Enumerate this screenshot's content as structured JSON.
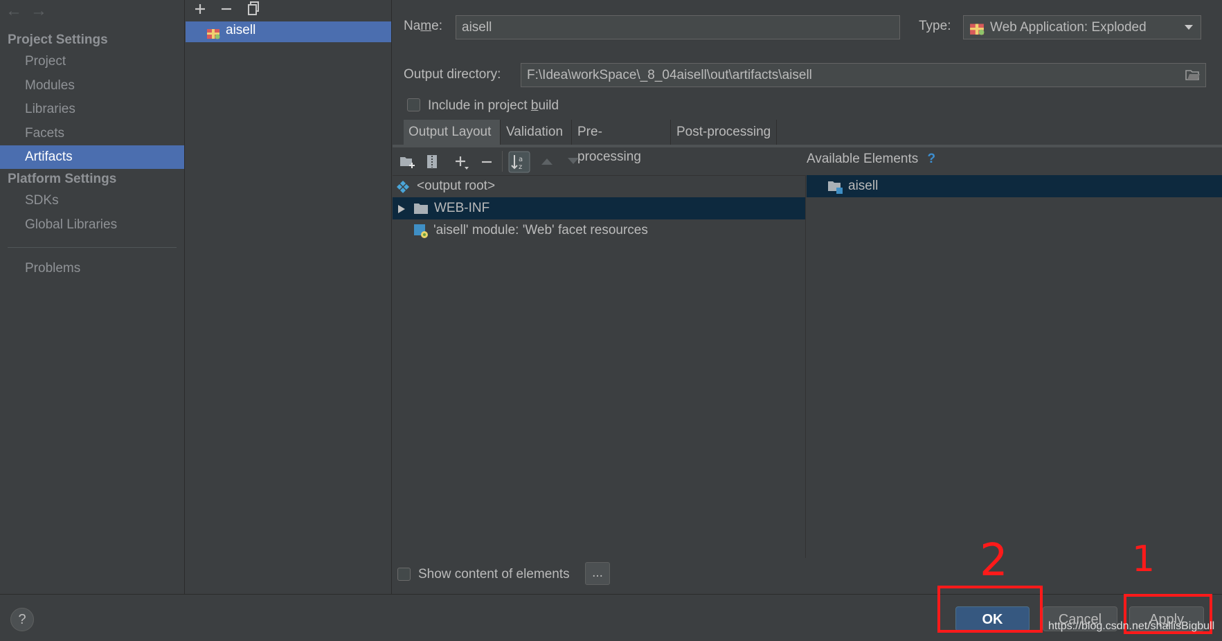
{
  "nav": {
    "back_arrow": "←",
    "forward_arrow": "→",
    "project_settings_header": "Project Settings",
    "project_items": [
      {
        "label": "Project"
      },
      {
        "label": "Modules"
      },
      {
        "label": "Libraries"
      },
      {
        "label": "Facets"
      },
      {
        "label": "Artifacts",
        "selected": true
      }
    ],
    "platform_settings_header": "Platform Settings",
    "platform_items": [
      {
        "label": "SDKs"
      },
      {
        "label": "Global Libraries"
      }
    ],
    "problems_label": "Problems"
  },
  "artifacts": {
    "toolbar_icons": [
      "add-icon",
      "remove-icon",
      "copy-icon"
    ],
    "items": [
      {
        "label": "aisell",
        "icon": "war-exploded-icon",
        "selected": true
      }
    ]
  },
  "details": {
    "name_label_prefix": "Na",
    "name_label_mnemonic": "m",
    "name_label_suffix": "e:",
    "name_value": "aisell",
    "type_label": "Type:",
    "type_value": "Web Application: Exploded",
    "output_dir_label": "Output directory:",
    "output_dir_value": "F:\\Idea\\workSpace\\_8_04aisell\\out\\artifacts\\aisell",
    "include_build_prefix": "Include in project ",
    "include_build_mnemonic": "b",
    "include_build_suffix": "uild",
    "include_build_checked": false
  },
  "tabs": [
    {
      "label": "Output Layout",
      "selected": true
    },
    {
      "label": "Validation"
    },
    {
      "label": "Pre-processing"
    },
    {
      "label": "Post-processing"
    }
  ],
  "layout": {
    "toolbar_icons": [
      "new-directory-icon",
      "archive-icon",
      "add-copy-icon",
      "remove-icon",
      "sort-icon",
      "move-up-icon",
      "move-down-icon"
    ],
    "tree": [
      {
        "label": "<output root>",
        "icon": "output-root-icon",
        "level": 0
      },
      {
        "label": "WEB-INF",
        "icon": "folder-icon",
        "level": 0,
        "expandable": true,
        "highlighted": true
      },
      {
        "label": "'aisell' module: 'Web' facet resources",
        "icon": "facet-resources-icon",
        "level": 1
      }
    ],
    "show_content_label": "Show content of elements",
    "show_content_checked": false,
    "more_button_label": "..."
  },
  "available": {
    "header": "Available Elements",
    "help_glyph": "?",
    "items": [
      {
        "label": "aisell",
        "icon": "module-folder-icon"
      }
    ]
  },
  "buttons": {
    "help": "?",
    "ok": "OK",
    "cancel": "Cancel",
    "apply": "Apply"
  },
  "annotations": {
    "ok_number": "2",
    "apply_number": "1",
    "color": "#ff1a1a"
  },
  "watermark": "https://blog.csdn.net/shallisBigbull",
  "colors": {
    "background": "#3c3f41",
    "selection": "#4b6eaf",
    "tree_highlight": "#0d293e",
    "default_button": "#365880"
  }
}
